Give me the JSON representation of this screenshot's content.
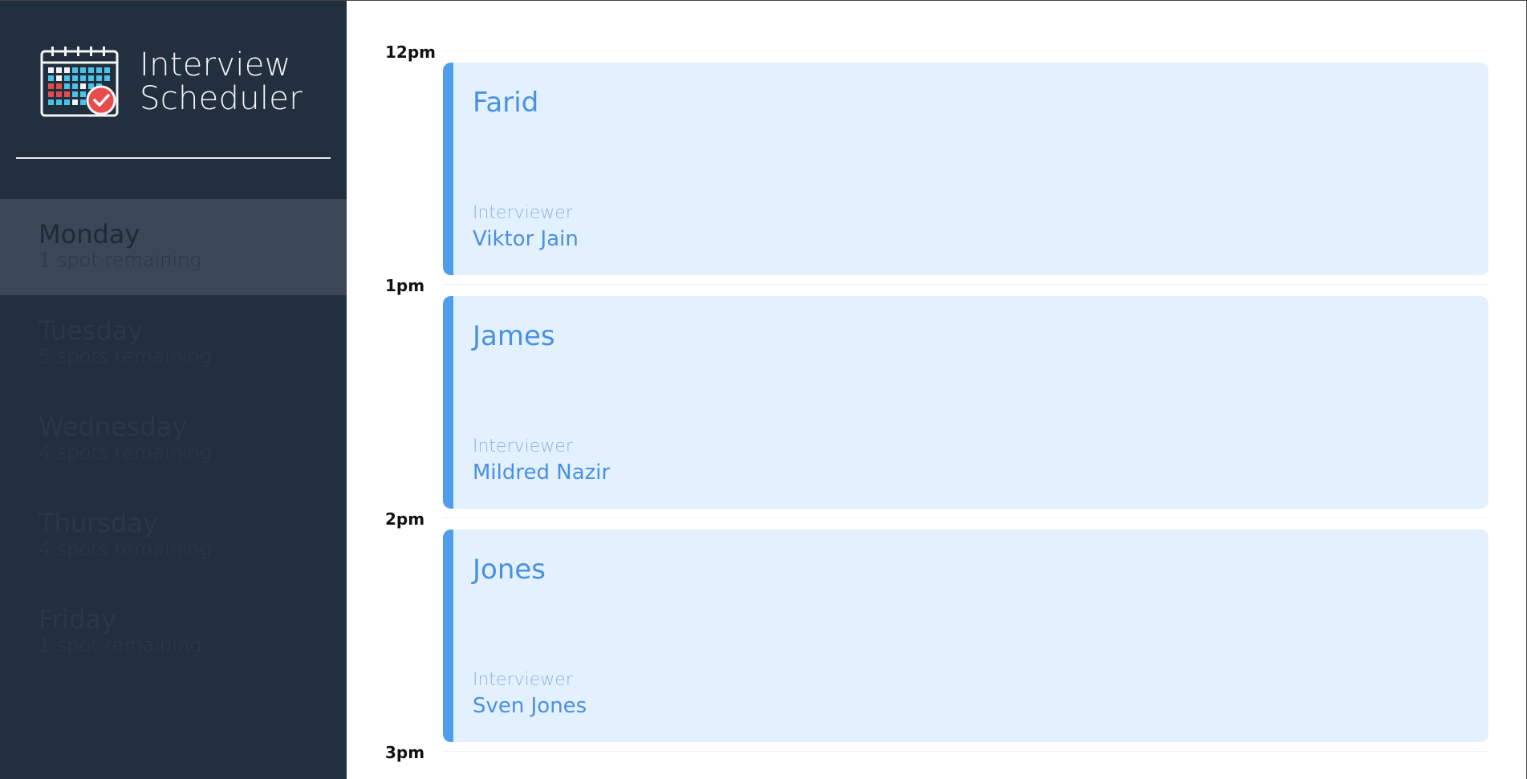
{
  "app": {
    "title_line1": "Interview",
    "title_line2": "Scheduler",
    "logo_icon": "calendar-check-icon"
  },
  "colors": {
    "sidebar_bg": "#222f3e",
    "selected_day_bg": "#3b4756",
    "appointment_bg": "#e3f0fd",
    "appointment_accent": "#4f9ded",
    "appointment_text": "#4a90e2"
  },
  "days": [
    {
      "name": "Monday",
      "spots": "1 spot remaining",
      "selected": true
    },
    {
      "name": "Tuesday",
      "spots": "5 spots remaining",
      "selected": false
    },
    {
      "name": "Wednesday",
      "spots": "4 spots remaining",
      "selected": false
    },
    {
      "name": "Thursday",
      "spots": "4 spots remaining",
      "selected": false
    },
    {
      "name": "Friday",
      "spots": "1 spot remaining",
      "selected": false
    }
  ],
  "schedule": {
    "slots": [
      {
        "time": "12pm",
        "student": "Farid",
        "interviewer_label": "Interviewer",
        "interviewer": "Viktor Jain"
      },
      {
        "time": "1pm",
        "student": "James",
        "interviewer_label": "Interviewer",
        "interviewer": "Mildred Nazir"
      },
      {
        "time": "2pm",
        "student": "Jones",
        "interviewer_label": "Interviewer",
        "interviewer": "Sven Jones"
      }
    ],
    "end_time": "3pm"
  }
}
